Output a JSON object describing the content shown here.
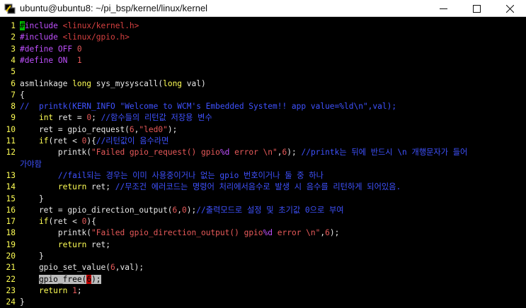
{
  "window": {
    "title": "ubuntu@ubuntu8: ~/pi_bsp/kernel/linux/kernel",
    "icon": "putty-terminal-icon",
    "buttons": [
      "minimize-icon",
      "maximize-icon",
      "close-icon"
    ]
  },
  "editor": {
    "colors": {
      "line_number": "#ffff55",
      "preprocessor": "#c050ff",
      "include_path": "#d64040",
      "keyword": "#ffff55",
      "text": "#e8e8e8",
      "string": "#e85a5a",
      "comment": "#3f52ff",
      "selection": "#bcbcbc",
      "cursor": "#c00000"
    },
    "lines": [
      {
        "n": "1",
        "tokens": [
          {
            "c": "cur0",
            "t": "#"
          },
          {
            "c": "pre",
            "t": "include "
          },
          {
            "c": "inc",
            "t": "<linux/kernel.h>"
          }
        ]
      },
      {
        "n": "2",
        "tokens": [
          {
            "c": "pre",
            "t": "#include "
          },
          {
            "c": "inc",
            "t": "<linux/gpio.h>"
          }
        ]
      },
      {
        "n": "3",
        "tokens": [
          {
            "c": "pre",
            "t": "#define OFF "
          },
          {
            "c": "num",
            "t": "0"
          }
        ]
      },
      {
        "n": "4",
        "tokens": [
          {
            "c": "pre",
            "t": "#define ON  "
          },
          {
            "c": "num",
            "t": "1"
          }
        ]
      },
      {
        "n": "5",
        "tokens": []
      },
      {
        "n": "6",
        "tokens": [
          {
            "c": "txt",
            "t": "asmlinkage "
          },
          {
            "c": "kw",
            "t": "long"
          },
          {
            "c": "txt",
            "t": " sys_mysyscall("
          },
          {
            "c": "kw",
            "t": "long"
          },
          {
            "c": "txt",
            "t": " val)"
          }
        ]
      },
      {
        "n": "7",
        "tokens": [
          {
            "c": "txt",
            "t": "{"
          }
        ]
      },
      {
        "n": "8",
        "tokens": [
          {
            "c": "com",
            "t": "//  printk(KERN_INFO \"Welcome to WCM's Embedded System!! app value=%ld\\n\",val);"
          }
        ]
      },
      {
        "n": "9",
        "tokens": [
          {
            "c": "txt",
            "t": "    "
          },
          {
            "c": "kw",
            "t": "int"
          },
          {
            "c": "txt",
            "t": " ret = "
          },
          {
            "c": "num",
            "t": "0"
          },
          {
            "c": "txt",
            "t": "; "
          },
          {
            "c": "com",
            "t": "//함수들의 리턴값 저장용 변수"
          }
        ]
      },
      {
        "n": "10",
        "tokens": [
          {
            "c": "txt",
            "t": "    ret = gpio_request("
          },
          {
            "c": "num",
            "t": "6"
          },
          {
            "c": "txt",
            "t": ","
          },
          {
            "c": "str",
            "t": "\"led0\""
          },
          {
            "c": "txt",
            "t": ");"
          }
        ]
      },
      {
        "n": "11",
        "tokens": [
          {
            "c": "txt",
            "t": "    "
          },
          {
            "c": "kw",
            "t": "if"
          },
          {
            "c": "txt",
            "t": "(ret < "
          },
          {
            "c": "num",
            "t": "0"
          },
          {
            "c": "txt",
            "t": "){"
          },
          {
            "c": "com",
            "t": "//리턴값이 음수라면"
          }
        ]
      },
      {
        "n": "12",
        "tokens": [
          {
            "c": "txt",
            "t": "        printk("
          },
          {
            "c": "str",
            "t": "\"Failed gpio_request() gpio"
          },
          {
            "c": "fmt",
            "t": "%d"
          },
          {
            "c": "str",
            "t": " error \\n\""
          },
          {
            "c": "txt",
            "t": ","
          },
          {
            "c": "num",
            "t": "6"
          },
          {
            "c": "txt",
            "t": "); "
          },
          {
            "c": "com",
            "t": "//printk는 뒤에 반드시 \\n 개행문자가 들어"
          }
        ]
      },
      {
        "n": "",
        "tokens": [
          {
            "c": "com",
            "t": "가야함"
          }
        ]
      },
      {
        "n": "13",
        "tokens": [
          {
            "c": "txt",
            "t": "        "
          },
          {
            "c": "com",
            "t": "//fail되는 경우는 이미 사용중이거나 없는 gpio 번호이거나 둘 중 하나"
          }
        ]
      },
      {
        "n": "14",
        "tokens": [
          {
            "c": "txt",
            "t": "        "
          },
          {
            "c": "kw",
            "t": "return"
          },
          {
            "c": "txt",
            "t": " ret; "
          },
          {
            "c": "com",
            "t": "//무조건 에러코드는 명령어 처리에서음수로 발생 시 음수를 리턴하게 되어있음."
          }
        ]
      },
      {
        "n": "15",
        "tokens": [
          {
            "c": "txt",
            "t": "    }"
          }
        ]
      },
      {
        "n": "16",
        "tokens": [
          {
            "c": "txt",
            "t": "    ret = gpio_direction_output("
          },
          {
            "c": "num",
            "t": "6"
          },
          {
            "c": "txt",
            "t": ","
          },
          {
            "c": "num",
            "t": "0"
          },
          {
            "c": "txt",
            "t": ");"
          },
          {
            "c": "com",
            "t": "//출력모드로 설정 및 초기값 0으로 부여"
          }
        ]
      },
      {
        "n": "17",
        "tokens": [
          {
            "c": "txt",
            "t": "    "
          },
          {
            "c": "kw",
            "t": "if"
          },
          {
            "c": "txt",
            "t": "(ret < "
          },
          {
            "c": "num",
            "t": "0"
          },
          {
            "c": "txt",
            "t": "){"
          }
        ]
      },
      {
        "n": "18",
        "tokens": [
          {
            "c": "txt",
            "t": "        printk("
          },
          {
            "c": "str",
            "t": "\"Failed gpio_direction_output() gpio"
          },
          {
            "c": "fmt",
            "t": "%d"
          },
          {
            "c": "str",
            "t": " error \\n\""
          },
          {
            "c": "txt",
            "t": ","
          },
          {
            "c": "num",
            "t": "6"
          },
          {
            "c": "txt",
            "t": ");"
          }
        ]
      },
      {
        "n": "19",
        "tokens": [
          {
            "c": "txt",
            "t": "        "
          },
          {
            "c": "kw",
            "t": "return"
          },
          {
            "c": "txt",
            "t": " ret;"
          }
        ]
      },
      {
        "n": "20",
        "tokens": [
          {
            "c": "txt",
            "t": "    }"
          }
        ]
      },
      {
        "n": "21",
        "tokens": [
          {
            "c": "txt",
            "t": "    gpio_set_value("
          },
          {
            "c": "num",
            "t": "6"
          },
          {
            "c": "txt",
            "t": ",val);"
          }
        ]
      },
      {
        "n": "22",
        "tokens": [
          {
            "c": "txt",
            "t": "    "
          },
          {
            "c": "hl",
            "t": "gpio_free("
          },
          {
            "c": "cur",
            "t": "6"
          },
          {
            "c": "hl",
            "t": ");"
          }
        ]
      },
      {
        "n": "23",
        "tokens": [
          {
            "c": "txt",
            "t": "    "
          },
          {
            "c": "kw",
            "t": "return"
          },
          {
            "c": "txt",
            "t": " "
          },
          {
            "c": "num",
            "t": "1"
          },
          {
            "c": "txt",
            "t": ";"
          }
        ]
      },
      {
        "n": "24",
        "tokens": [
          {
            "c": "txt",
            "t": "}"
          }
        ]
      }
    ]
  }
}
